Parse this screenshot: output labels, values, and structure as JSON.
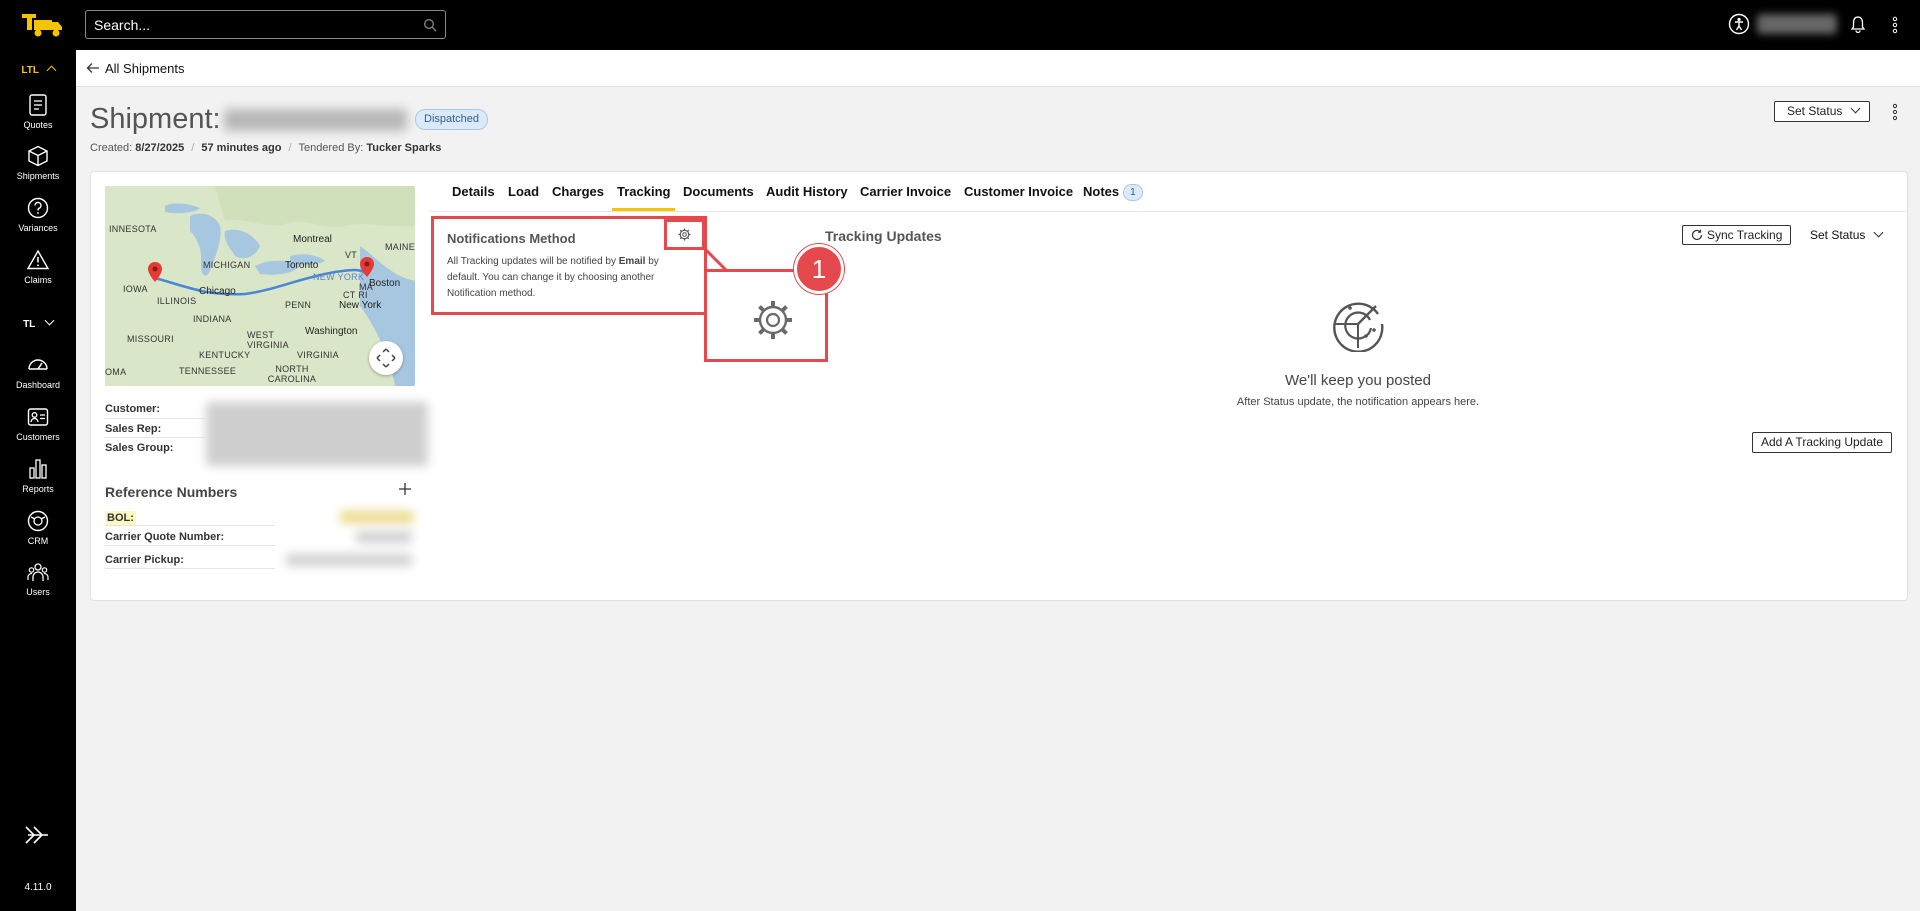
{
  "topbar": {
    "search_placeholder": "Search..."
  },
  "sidebar": {
    "ltl_label": "LTL",
    "tl_label": "TL",
    "items": [
      {
        "label": "Quotes",
        "icon": "quotes-icon"
      },
      {
        "label": "Shipments",
        "icon": "box-icon"
      },
      {
        "label": "Variances",
        "icon": "question-circle-icon"
      },
      {
        "label": "Claims",
        "icon": "warning-triangle-icon"
      },
      {
        "label": "Dashboard",
        "icon": "gauge-icon"
      },
      {
        "label": "Customers",
        "icon": "contact-card-icon"
      },
      {
        "label": "Reports",
        "icon": "bar-chart-icon"
      },
      {
        "label": "CRM",
        "icon": "crm-icon"
      },
      {
        "label": "Users",
        "icon": "users-icon"
      }
    ],
    "version": "4.11.0"
  },
  "breadcrumb": {
    "back_label": "All Shipments"
  },
  "shipment": {
    "title_prefix": "Shipment:",
    "status": "Dispatched",
    "created_label": "Created:",
    "created_date": "8/27/2025",
    "age": "57 minutes ago",
    "tendered_label": "Tendered By:",
    "tendered_by": "Tucker Sparks",
    "set_status_label": "Set Status"
  },
  "map": {
    "regions": [
      "INNESOTA",
      "MICHIGAN",
      "MAINE",
      "VT",
      "IOWA",
      "ILLINOIS",
      "NEW YORK",
      "MA",
      "CT RI",
      "INDIANA",
      "PENN",
      "MISSOURI",
      "WEST VIRGINIA",
      "KENTUCKY",
      "VIRGINIA",
      "NORTH CAROLINA",
      "TENNESSEE",
      "OMA"
    ],
    "cities": [
      "Montreal",
      "Toronto",
      "Chicago",
      "Boston",
      "New York",
      "Washington"
    ]
  },
  "details": {
    "customer_label": "Customer:",
    "sales_rep_label": "Sales Rep:",
    "sales_group_label": "Sales Group:"
  },
  "reference": {
    "title": "Reference Numbers",
    "bol_label": "BOL:",
    "carrier_quote_label": "Carrier Quote Number:",
    "carrier_pickup_label": "Carrier Pickup:"
  },
  "tabs": [
    "Details",
    "Load",
    "Charges",
    "Tracking",
    "Documents",
    "Audit History",
    "Carrier Invoice",
    "Customer Invoice",
    "Notes"
  ],
  "notes_count": "1",
  "active_tab": "Tracking",
  "notifications": {
    "title": "Notifications Method",
    "text_before": "All Tracking updates will be notified by ",
    "text_bold": "Email",
    "text_after": " by default. You can change it by choosing another Notification method."
  },
  "callout": {
    "number": "1"
  },
  "tracking": {
    "title": "Tracking Updates",
    "sync_label": "Sync Tracking",
    "set_status_label": "Set Status",
    "empty_title": "We'll keep you posted",
    "empty_subtitle": "After Status update, the notification appears here.",
    "add_label": "Add A Tracking Update"
  },
  "colors": {
    "accent": "#f5c400",
    "highlight_red": "#e5484d",
    "badge_blue": "#dbeafb"
  }
}
